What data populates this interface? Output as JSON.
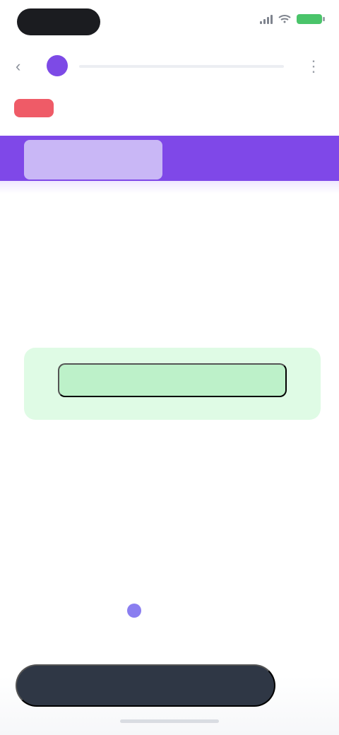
{
  "status_bar": {
    "time": "",
    "battery_color": "#4ac46a"
  },
  "app_bar": {
    "back_icon": "arrow-left-icon",
    "brand_icon": "brand-circle-icon",
    "menu_icon": "more-vertical-icon"
  },
  "sub_header": {
    "logo_text": "",
    "link_text": ""
  },
  "banner": {
    "title": ""
  },
  "content": {
    "intro_text": "",
    "paragraph_1": "",
    "cta_label": "",
    "paragraph_2": "",
    "paragraph_3": ""
  },
  "footer": {
    "note_text": "",
    "icon": "circle-icon"
  },
  "bottom": {
    "primary_button": "",
    "side_label": ""
  },
  "colors": {
    "primary": "#7f48e8",
    "cta_bg": "#dffbe5",
    "cta_button": "#bdf1c9",
    "alert": "#ef5b67",
    "dark_button": "#2f3745"
  }
}
